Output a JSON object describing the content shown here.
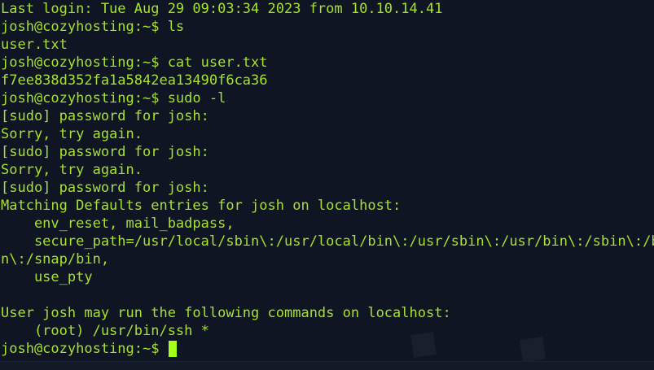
{
  "terminal": {
    "colors": {
      "background": "#0f1522",
      "text": "#a6e22e",
      "cursor": "#a6ff1a"
    },
    "lines": [
      "Last login: Tue Aug 29 09:03:34 2023 from 10.10.14.41",
      "josh@cozyhosting:~$ ls",
      "user.txt",
      "josh@cozyhosting:~$ cat user.txt",
      "f7ee838d352fa1a5842ea13490f6ca36",
      "josh@cozyhosting:~$ sudo -l",
      "[sudo] password for josh: ",
      "Sorry, try again.",
      "[sudo] password for josh: ",
      "Sorry, try again.",
      "[sudo] password for josh: ",
      "Matching Defaults entries for josh on localhost:",
      "    env_reset, mail_badpass,",
      "    secure_path=/usr/local/sbin\\:/usr/local/bin\\:/usr/sbin\\:/usr/bin\\:/sbin\\:/bi",
      "n\\:/snap/bin,",
      "    use_pty",
      "",
      "User josh may run the following commands on localhost:",
      "    (root) /usr/bin/ssh *"
    ],
    "prompt": "josh@cozyhosting:~$ "
  }
}
